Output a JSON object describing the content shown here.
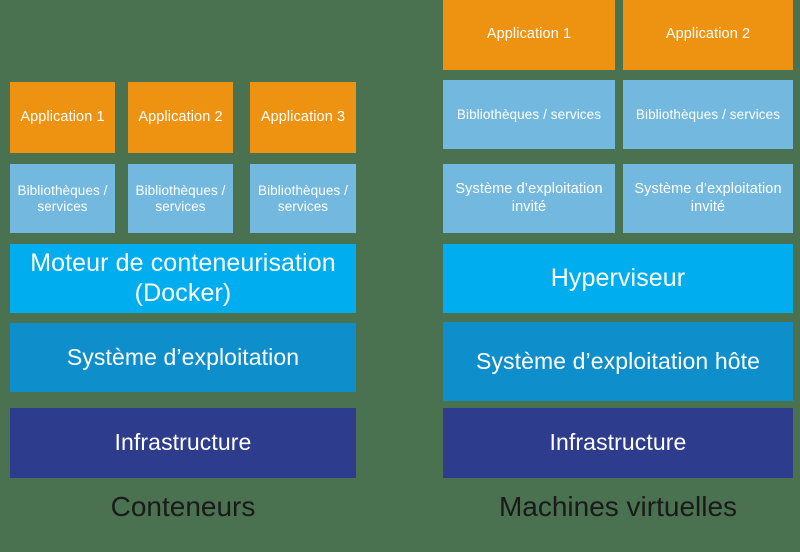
{
  "background_color": "#4a7150",
  "palette": {
    "application": "#ed9211",
    "libraries": "#73b9df",
    "engine": "#00aeef",
    "os": "#0e8fcb",
    "infrastructure": "#2e3c8e",
    "box_text": "#ffffff",
    "caption_text": "#1a1a1a"
  },
  "containers": {
    "caption": "Conteneurs",
    "applications": [
      {
        "label": "Application 1"
      },
      {
        "label": "Application 2"
      },
      {
        "label": "Application 3"
      }
    ],
    "libraries": [
      {
        "label": "Bibliothèques / services"
      },
      {
        "label": "Bibliothèques / services"
      },
      {
        "label": "Bibliothèques / services"
      }
    ],
    "engine": "Moteur de conteneurisation (Docker)",
    "operating_system": "Système d’exploitation",
    "infrastructure": "Infrastructure"
  },
  "virtual_machines": {
    "caption": "Machines virtuelles",
    "applications": [
      {
        "label": "Application 1"
      },
      {
        "label": "Application 2"
      }
    ],
    "libraries": [
      {
        "label": "Bibliothèques / services"
      },
      {
        "label": "Bibliothèques / services"
      }
    ],
    "guest_operating_systems": [
      {
        "label": "Système d’exploitation invité"
      },
      {
        "label": "Système d’exploitation invité"
      }
    ],
    "hypervisor": "Hyperviseur",
    "host_operating_system": "Système d’exploitation hôte",
    "infrastructure": "Infrastructure"
  }
}
